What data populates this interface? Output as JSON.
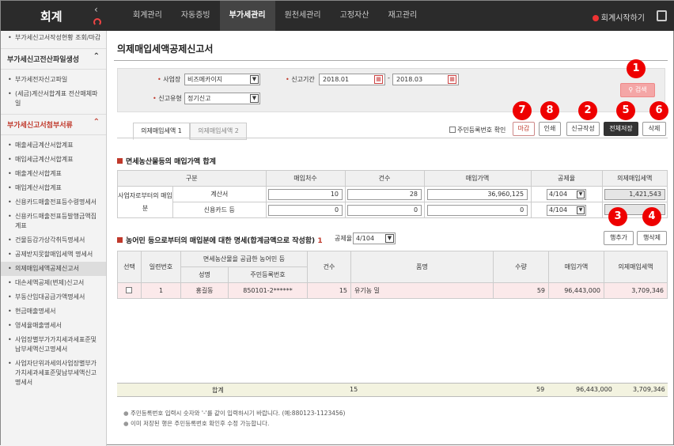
{
  "app": {
    "logo": "회계",
    "nav": [
      "회계관리",
      "자동증빙",
      "부가세관리",
      "원천세관리",
      "고정자산",
      "재고관리"
    ],
    "nav_active": 2,
    "start": "회계시작하기"
  },
  "sidebar": {
    "top": [
      "부가세신고서작성현황 조회/마감"
    ],
    "head1": "부가세신고전산파일생성",
    "group1": [
      "부가세전자신고파일",
      "(세금)계산서합계표 전산매체파일"
    ],
    "head2": "부가세신고서첨부서류",
    "group2": [
      "매출세금계산서합계표",
      "매입세금계산서합계표",
      "매출계산서합계표",
      "매입계산서합계표",
      "신용카드매출전표등수령명세서",
      "신용카드매출전표등발행금액집계표",
      "건물등감가상각취득명세서",
      "공제받지못할매입세액 명세서",
      "의제매입세액공제신고서",
      "대손세액공제(변제)신고서",
      "부동산임대공급가액명세서",
      "현금매출명세서",
      "영세율매출명세서",
      "사업장별부가가치세과세표준및납부세액신고명세서",
      "사업자단위과세의사업장별부가가치세과세표준및납부세액신고명세서"
    ],
    "selected_index": 8
  },
  "page": {
    "title": "의제매입세액공제신고서"
  },
  "filter": {
    "biz_label": "사업장",
    "biz_value": "비즈메카이지",
    "period_label": "신고기간",
    "from": "2018.01",
    "sep": "-",
    "to": "2018.03",
    "type_label": "신고유형",
    "type_value": "정기신고",
    "search": "검색"
  },
  "tabs": [
    "의제매입세액 1",
    "의제매입세액 2"
  ],
  "actions": {
    "rrn_check": "주민등록번호 확인",
    "close": "마감",
    "print": "인쇄",
    "new": "신규작성",
    "save_all": "전체저장",
    "delete": "삭제",
    "add_row": "행추가",
    "del_row": "행삭제"
  },
  "badges": [
    "1",
    "7",
    "8",
    "2",
    "5",
    "6",
    "3",
    "4"
  ],
  "sec1": {
    "title": "면세농산물등의 매입가액 합계",
    "headers": [
      "구분",
      "매입처수",
      "건수",
      "매입가액",
      "공제율",
      "의제매입세액"
    ],
    "group": "사업자로부터의 매입분",
    "rows": [
      {
        "name": "계산서",
        "vendors": "10",
        "count": "28",
        "amount": "36,960,125",
        "rate": "4/104",
        "tax": "1,421,543"
      },
      {
        "name": "신용카드 등",
        "vendors": "0",
        "count": "0",
        "amount": "0",
        "rate": "4/104",
        "tax": ""
      }
    ]
  },
  "sec2": {
    "title": "농어민 등으로부터의 매입분에 대한 명세(합계금액으로 작성함)",
    "title_suffix": "1",
    "rate_label": "공제율",
    "rate_value": "4/104",
    "headers": {
      "select": "선택",
      "seq": "일련번호",
      "supplier": "면세농산물을 공급한 농어민 등",
      "name": "성명",
      "rrn": "주민등록번호",
      "count": "건수",
      "item": "품명",
      "qty": "수량",
      "amount": "매입가액",
      "tax": "의제매입세액"
    },
    "rows": [
      {
        "seq": "1",
        "name": "홍길동",
        "rrn": "850101-2******",
        "count": "15",
        "item": "유기농 밀",
        "qty": "59",
        "amount": "96,443,000",
        "tax": "3,709,346"
      }
    ],
    "total": {
      "label": "합계",
      "count": "15",
      "qty": "59",
      "amount": "96,443,000",
      "tax": "3,709,346"
    }
  },
  "notes": [
    "주민등록번호 입력시 숫자와 '-'를 같이 입력하시기 바랍니다. (예:880123-1123456)",
    "이미 저장된 행은 주민등록번호 확인후 수정 가능합니다."
  ]
}
